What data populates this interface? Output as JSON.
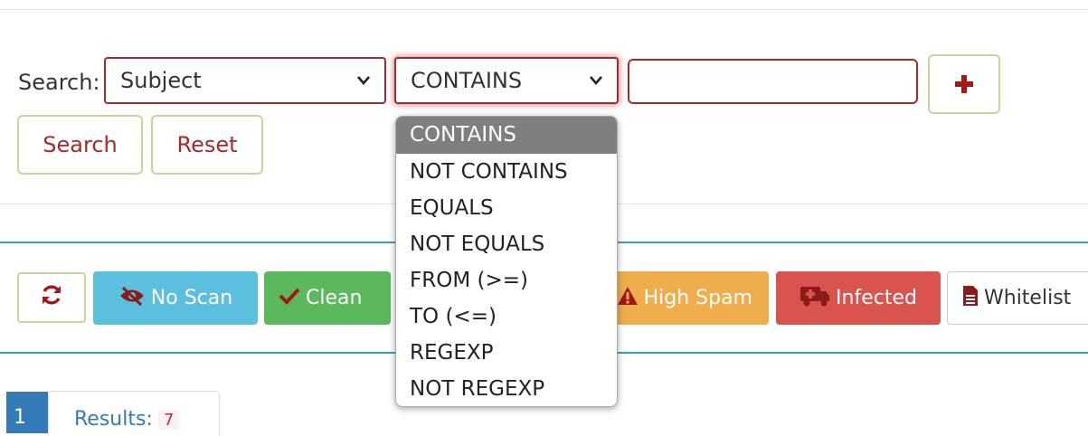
{
  "search": {
    "label": "Search:",
    "field_value": "Subject",
    "operator_value": "CONTAINS",
    "value": "",
    "search_button": "Search",
    "reset_button": "Reset"
  },
  "operator_options": [
    "CONTAINS",
    "NOT CONTAINS",
    "EQUALS",
    "NOT EQUALS",
    "FROM (>=)",
    "TO (<=)",
    "REGEXP",
    "NOT REGEXP"
  ],
  "filters": {
    "no_scan": "No Scan",
    "clean": "Clean",
    "high_spam": "High Spam",
    "infected": "Infected",
    "whitelist": "Whitelist"
  },
  "pagination": {
    "current_page": "1",
    "results_label": "Results:",
    "results_count": "7"
  },
  "colors": {
    "accent": "#a52a2a",
    "no_scan": "#5bc0de",
    "clean": "#5cb85c",
    "high_spam": "#f0ad4e",
    "infected": "#d9534f",
    "link": "#337ab7"
  },
  "icons": {
    "refresh": "refresh-icon",
    "no_scan": "eye-slash-icon",
    "clean": "check-icon",
    "high_spam": "warning-icon",
    "infected": "ambulance-icon",
    "whitelist": "file-text-icon",
    "add": "plus-icon",
    "dropdown": "chevron-down-icon"
  }
}
